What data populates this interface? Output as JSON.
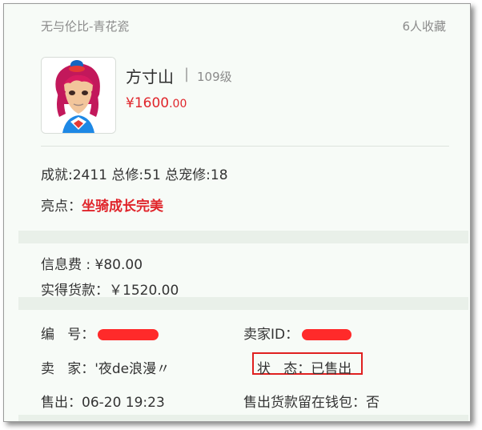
{
  "header": {
    "server": "无与伦比-青花瓷",
    "favorites": "6人收藏"
  },
  "role": {
    "avatar_icon": "character-portrait",
    "name": "方寸山",
    "separator": "|",
    "level": "109级",
    "price_main": "¥1600",
    "price_cents": ".00"
  },
  "stats": {
    "text": "成就:2411 总修:51 总宠修:18"
  },
  "highlight": {
    "label": "亮点：",
    "value": "坐骑成长完美"
  },
  "fees": {
    "info_fee": "信息费 : ¥80.00",
    "net_payment": "实得货款：￥1520.00"
  },
  "details": {
    "id_label": "编   号：",
    "seller_id_label": "卖家ID：",
    "seller_label": "卖   家：",
    "seller_value": "'夜de浪漫〃",
    "status_label": "状   态：",
    "status_value": "已售出",
    "sold_label": "售出：",
    "sold_value": "06-20 19:23",
    "wallet_label": "售出货款留在钱包：",
    "wallet_value": "否"
  },
  "colors": {
    "price": "#e0252b",
    "highlight": "#e0252b",
    "redaction": "#ff2a2a",
    "background": "#f7fbf7"
  }
}
